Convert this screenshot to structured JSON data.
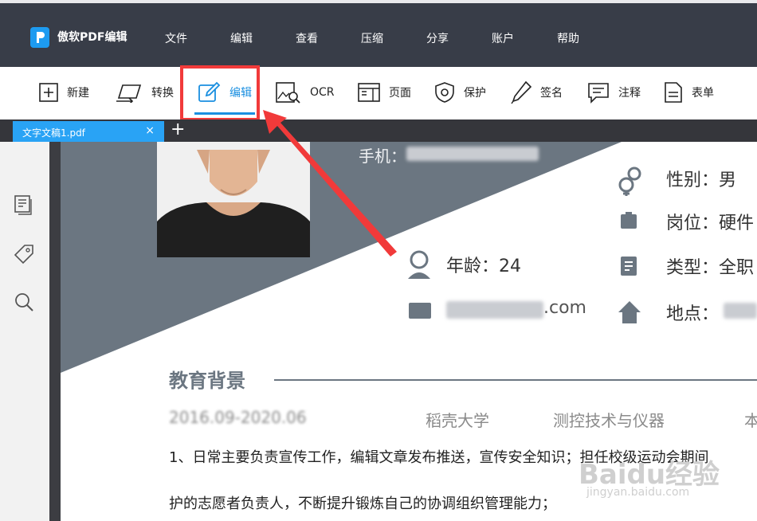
{
  "app": {
    "name": "傲软PDF编辑"
  },
  "menu": [
    "文件",
    "编辑",
    "查看",
    "压缩",
    "分享",
    "账户",
    "帮助"
  ],
  "toolbar": {
    "new": "新建",
    "convert": "转换",
    "edit": "编辑",
    "ocr": "OCR",
    "page": "页面",
    "protect": "保护",
    "sign": "签名",
    "comment": "注释",
    "form": "表单"
  },
  "tab": {
    "title": "文字文稿1.pdf",
    "close": "×",
    "add": "+"
  },
  "doc": {
    "phone_label": "手机：",
    "gender": "性别：男",
    "post": "岗位：硬件",
    "age": "年龄：24",
    "type": "类型：全职",
    "email_suffix": ".com",
    "location": "地点：",
    "section_title": "教育背景",
    "date": "2016.09-2020.06",
    "school": "稻壳大学",
    "major": "测控技术与仪器",
    "degree_partial": "本",
    "para1": "1、日常主要负责宣传工作，编辑文章发布推送，宣传安全知识；担任校级运动会期间",
    "para2": "护的志愿者负责人，不断提升锻炼自己的协调组织管理能力；"
  },
  "watermark": {
    "brand": "Baidu经验",
    "url": "jingyan.baidu.com"
  },
  "colors": {
    "menubar": "#383d48",
    "accent": "#1a8fe0",
    "highlight": "#f13a3a",
    "tab": "#29a3f5",
    "slate": "#6b7681"
  }
}
